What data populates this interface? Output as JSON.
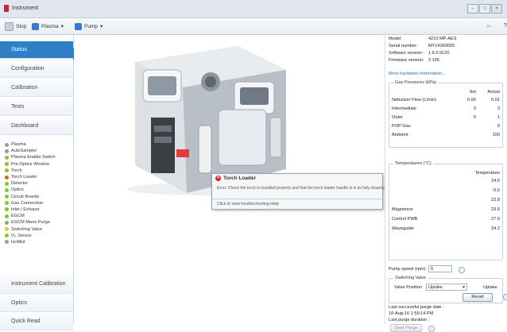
{
  "window": {
    "title": "Instrument",
    "buttons": [
      "–",
      "□",
      "×"
    ]
  },
  "toolbar": {
    "stop": "Stop",
    "plasma": "Plasma",
    "pump": "Pump",
    "back_symbol": "⇦",
    "help_symbol": "?"
  },
  "nav": {
    "items": [
      "Status",
      "Configuration",
      "Calibration",
      "Tests",
      "Dashboard"
    ],
    "bottom": [
      "Instrument Calibration",
      "Optics",
      "Quick Read"
    ]
  },
  "status_items": [
    {
      "label": "Plasma",
      "color": "#9a9a9a"
    },
    {
      "label": "AutoSampler",
      "color": "#9a9a9a"
    },
    {
      "label": "Plasma Enable Switch",
      "color": "#86c430"
    },
    {
      "label": "Pre-Optics Window",
      "color": "#86c430"
    },
    {
      "label": "Torch",
      "color": "#86c430"
    },
    {
      "label": "Torch Loader",
      "color": "#e05a2b"
    },
    {
      "label": "Detector",
      "color": "#86c430"
    },
    {
      "label": "Optics",
      "color": "#86c430"
    },
    {
      "label": "Circuit Boards",
      "color": "#86c430"
    },
    {
      "label": "Gas Connection",
      "color": "#86c430"
    },
    {
      "label": "Inlet / Exhaust",
      "color": "#86c430"
    },
    {
      "label": "EGCM",
      "color": "#86c430"
    },
    {
      "label": "EGCM Mono Purge",
      "color": "#9a9a9a"
    },
    {
      "label": "Switching Valve",
      "color": "#e8c62c"
    },
    {
      "label": "O₂ Sensor",
      "color": "#86c430"
    },
    {
      "label": "IsoMist",
      "color": "#9a9a9a"
    }
  ],
  "error_popup": {
    "title": "Torch Loader",
    "message": "Error: Check the torch is installed properly and that the torch loader handle is in its fully closed position.",
    "link": "Click to view troubleshooting Help"
  },
  "info": {
    "model_label": "Model:",
    "model": "4210 MP-AES",
    "serial_label": "Serial number:",
    "serial": "MY14360005",
    "software_label": "Software version:",
    "software": "1.6.0.9120",
    "firmware_label": "Firmware version:",
    "firmware": "2.105",
    "more_link": "More hardware information..."
  },
  "gas": {
    "title": "Gas Pressures (kPa)",
    "set_header": "Set",
    "actual_header": "Actual",
    "rows": [
      {
        "name": "Nebulizer Flow (L/min)",
        "set": "0.00",
        "actual": "0.01"
      },
      {
        "name": "Intermediate",
        "set": "0",
        "actual": "3"
      },
      {
        "name": "Outer",
        "set": "0",
        "actual": "1"
      },
      {
        "name": "POP Gas",
        "set": "",
        "actual": "0"
      },
      {
        "name": "Ambient",
        "set": "",
        "actual": "100"
      }
    ]
  },
  "temps": {
    "title": "Temperatures (°C)",
    "header": "Temperature",
    "rows": [
      {
        "name": "",
        "value": "24.5"
      },
      {
        "name": "",
        "value": "-0.5"
      },
      {
        "name": "",
        "value": "22.8"
      },
      {
        "name": "Magnetron",
        "value": "23.6"
      },
      {
        "name": "Control PWB",
        "value": "27.9"
      },
      {
        "name": "Waveguide",
        "value": "24.2"
      }
    ]
  },
  "pump": {
    "label": "Pump speed (rpm):",
    "value": "0"
  },
  "valve": {
    "title": "Switching Valve",
    "position_label": "Valve Position",
    "position_value": "Uptake",
    "status": "Uptake",
    "reset": "Reset"
  },
  "purge": {
    "last_label": "Last successful purge date :",
    "last_value": "10-Aug-16 1:59:14 PM",
    "duration_label": "Last purge duration :",
    "start": "Start Purge"
  }
}
